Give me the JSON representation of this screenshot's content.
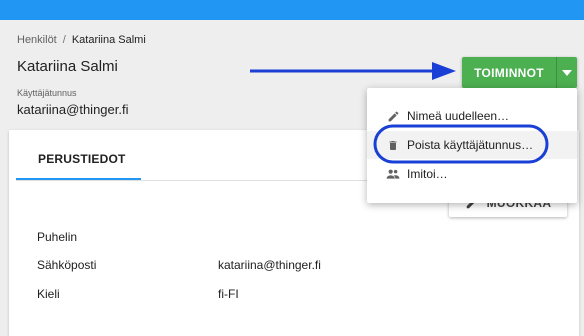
{
  "breadcrumb": {
    "root": "Henkilöt",
    "separator": "/",
    "current": "Katariina Salmi"
  },
  "page": {
    "title": "Katariina Salmi",
    "username_label": "Käyttäjätunnus",
    "username_value": "katariina@thinger.fi"
  },
  "actions": {
    "main_label": "TOIMINNOT",
    "caret_icon": "caret-down-icon"
  },
  "menu": {
    "items": [
      {
        "label": "Nimeä uudelleen…",
        "icon": "pencil-icon"
      },
      {
        "label": "Poista käyttäjätunnus…",
        "icon": "trash-icon"
      },
      {
        "label": "Imitoi…",
        "icon": "people-icon"
      }
    ]
  },
  "tabs": [
    {
      "label": "PERUSTIEDOT",
      "active": true
    }
  ],
  "edit_button": {
    "label": "MUOKKAA",
    "icon": "pencil-icon"
  },
  "details": [
    {
      "label": "Puhelin",
      "value": ""
    },
    {
      "label": "Sähköposti",
      "value": "katariina@thinger.fi"
    },
    {
      "label": "Kieli",
      "value": "fi-FI"
    }
  ],
  "colors": {
    "topbar": "#2196f3",
    "actions_green": "#4caf50",
    "annotation_blue": "#1a3fd6",
    "tab_indicator": "#2196f3"
  }
}
